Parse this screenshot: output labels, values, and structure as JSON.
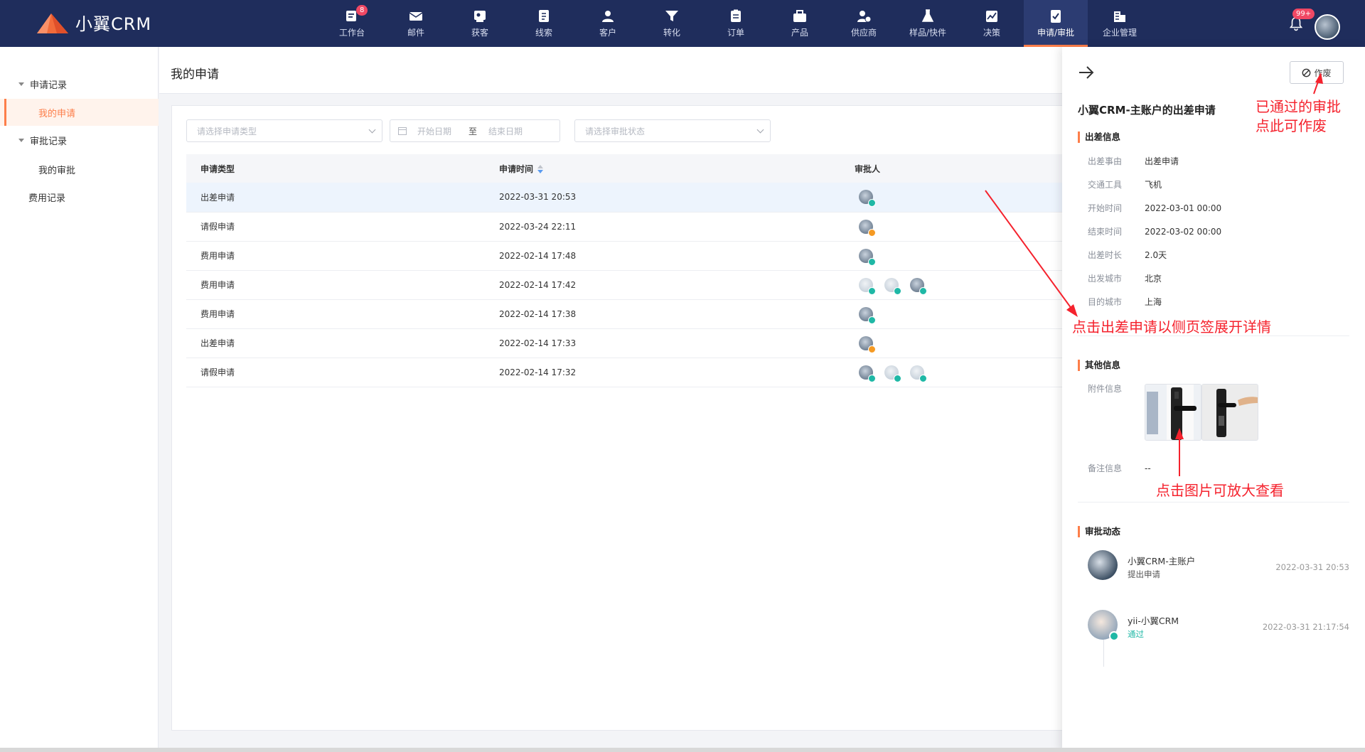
{
  "brand": {
    "name": "小翼CRM"
  },
  "nav": {
    "items": [
      {
        "label": "工作台",
        "icon": "workbench-icon",
        "badge": "8"
      },
      {
        "label": "邮件",
        "icon": "mail-icon"
      },
      {
        "label": "获客",
        "icon": "acquire-icon"
      },
      {
        "label": "线索",
        "icon": "lead-icon"
      },
      {
        "label": "客户",
        "icon": "customer-icon"
      },
      {
        "label": "转化",
        "icon": "funnel-icon"
      },
      {
        "label": "订单",
        "icon": "order-icon"
      },
      {
        "label": "产品",
        "icon": "product-icon"
      },
      {
        "label": "供应商",
        "icon": "supplier-icon"
      },
      {
        "label": "样品/快件",
        "icon": "sample-icon"
      },
      {
        "label": "决策",
        "icon": "chart-icon"
      },
      {
        "label": "申请/审批",
        "icon": "approval-icon",
        "active": true
      },
      {
        "label": "企业管理",
        "icon": "company-icon"
      }
    ],
    "notification_badge": "99+"
  },
  "sidebar": {
    "groups": [
      {
        "label": "申请记录",
        "items": [
          {
            "label": "我的申请",
            "active": true
          }
        ]
      },
      {
        "label": "审批记录",
        "items": [
          {
            "label": "我的审批"
          }
        ]
      }
    ],
    "extra": "费用记录"
  },
  "page": {
    "title": "我的申请"
  },
  "filters": {
    "type_placeholder": "请选择申请类型",
    "start_placeholder": "开始日期",
    "range_sep": "至",
    "end_placeholder": "结束日期",
    "status_placeholder": "请选择审批状态"
  },
  "table": {
    "columns": [
      "申请类型",
      "申请时间",
      "审批人"
    ],
    "rows": [
      {
        "type": "出差申请",
        "time": "2022-03-31 20:53",
        "approvers": [
          {
            "style": "dark",
            "status": "ok"
          }
        ]
      },
      {
        "type": "请假申请",
        "time": "2022-03-24 22:11",
        "approvers": [
          {
            "style": "dark",
            "status": "pend"
          }
        ]
      },
      {
        "type": "费用申请",
        "time": "2022-02-14 17:48",
        "approvers": [
          {
            "style": "dark",
            "status": "ok"
          }
        ]
      },
      {
        "type": "费用申请",
        "time": "2022-02-14 17:42",
        "approvers": [
          {
            "style": "light",
            "status": "ok"
          },
          {
            "style": "light",
            "status": "ok"
          },
          {
            "style": "dark",
            "status": "ok"
          }
        ]
      },
      {
        "type": "费用申请",
        "time": "2022-02-14 17:38",
        "approvers": [
          {
            "style": "dark",
            "status": "ok"
          }
        ]
      },
      {
        "type": "出差申请",
        "time": "2022-02-14 17:33",
        "approvers": [
          {
            "style": "dark",
            "status": "pend"
          }
        ]
      },
      {
        "type": "请假申请",
        "time": "2022-02-14 17:32",
        "approvers": [
          {
            "style": "dark",
            "status": "ok"
          },
          {
            "style": "light",
            "status": "ok"
          },
          {
            "style": "light",
            "status": "ok"
          }
        ]
      }
    ]
  },
  "drawer": {
    "void_label": "作废",
    "title": "小翼CRM-主账户的出差申请",
    "trip_section": "出差信息",
    "trip_fields": [
      {
        "k": "出差事由",
        "v": "出差申请"
      },
      {
        "k": "交通工具",
        "v": "飞机"
      },
      {
        "k": "开始时间",
        "v": "2022-03-01 00:00"
      },
      {
        "k": "结束时间",
        "v": "2022-03-02 00:00"
      },
      {
        "k": "出差时长",
        "v": "2.0天"
      },
      {
        "k": "出发城市",
        "v": "北京"
      },
      {
        "k": "目的城市",
        "v": "上海"
      }
    ],
    "other_section": "其他信息",
    "attachment_label": "附件信息",
    "remark_label": "备注信息",
    "remark_value": "--",
    "timeline_section": "审批动态",
    "timeline": [
      {
        "name": "小翼CRM-主账户",
        "action": "提出申请",
        "time": "2022-03-31 20:53"
      },
      {
        "name": "yii-小翼CRM",
        "action": "通过",
        "time": "2022-03-31 21:17:54"
      }
    ]
  },
  "annotations": {
    "void_note_line1": "已通过的审批",
    "void_note_line2": "点此可作废",
    "drawer_note": "点击出差申请以侧页签展开详情",
    "image_note": "点击图片可放大查看",
    "color": "#f5222d"
  },
  "colors": {
    "nav_bg": "#1f2d5c",
    "accent": "#fd7e4a",
    "ok": "#1fb8a6",
    "pending": "#f59a23"
  }
}
